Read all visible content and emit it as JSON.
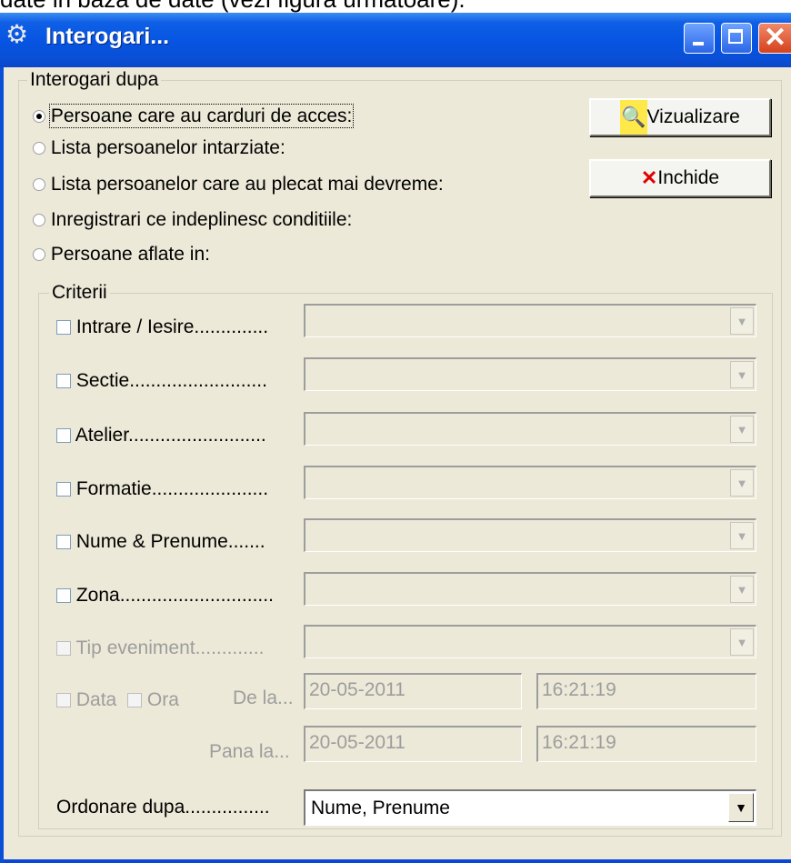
{
  "document": {
    "caption_text": "date in baza de date (vezi figura urmatoare)."
  },
  "window": {
    "title": "Interogari...",
    "title_icon": "gear-icon"
  },
  "query_group": {
    "label": "Interogari dupa",
    "options": [
      {
        "label": "Persoane care au carduri de acces:",
        "selected": true
      },
      {
        "label": "Lista persoanelor intarziate:",
        "selected": false
      },
      {
        "label": "Lista persoanelor care au plecat mai devreme:",
        "selected": false
      },
      {
        "label": "Inregistrari ce indeplinesc conditiile:",
        "selected": false
      },
      {
        "label": "Persoane aflate in:",
        "selected": false
      }
    ]
  },
  "buttons": {
    "view": {
      "label": "Vizualizare",
      "icon": "magnifier-page-icon"
    },
    "close": {
      "label": "Inchide",
      "icon": "red-x-icon"
    }
  },
  "criteria_group": {
    "label": "Criterii",
    "rows": [
      {
        "label": "Intrare / Iesire..............",
        "enabled": true
      },
      {
        "label": "Sectie..........................",
        "enabled": true
      },
      {
        "label": "Atelier..........................",
        "enabled": true
      },
      {
        "label": "Formatie......................",
        "enabled": true
      },
      {
        "label": "Nume & Prenume.......",
        "enabled": true
      },
      {
        "label": "Zona.............................",
        "enabled": true
      },
      {
        "label": "Tip eveniment.............",
        "enabled": false
      }
    ],
    "date_row": {
      "data_label": "Data",
      "ora_label": "Ora",
      "from_label": "De la...",
      "to_label": "Pana la...",
      "from_date": "20-05-2011",
      "from_time": "16:21:19",
      "to_date": "20-05-2011",
      "to_time": "16:21:19"
    }
  },
  "ordering": {
    "label": "Ordonare dupa................",
    "value": "Nume, Prenume"
  }
}
